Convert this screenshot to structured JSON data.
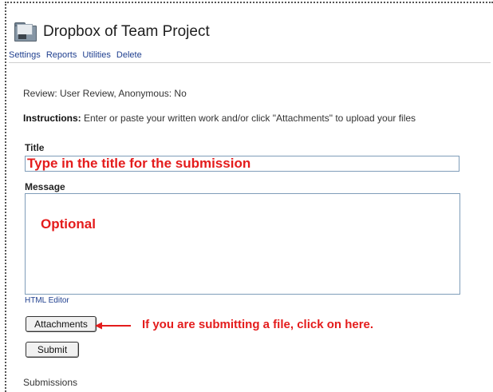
{
  "header": {
    "icon": "dropbox-folder-icon",
    "title": "Dropbox of Team Project"
  },
  "nav": {
    "items": [
      "Settings",
      "Reports",
      "Utilities",
      "Delete"
    ]
  },
  "review_line": "Review: User Review, Anonymous: No",
  "instructions": {
    "label": "Instructions:",
    "text": " Enter or paste your written work and/or click \"Attachments\" to upload your files"
  },
  "form": {
    "title_label": "Title",
    "title_value": "Type in the title for the submission",
    "message_label": "Message",
    "message_value": "Optional",
    "html_editor_label": "HTML Editor",
    "attachments_label": "Attachments",
    "submit_label": "Submit"
  },
  "annotation": {
    "text": "If you are submitting a file, click on here.",
    "color": "#e41c1c",
    "arrow_icon": "left-arrow-icon"
  },
  "submissions_label": "Submissions"
}
